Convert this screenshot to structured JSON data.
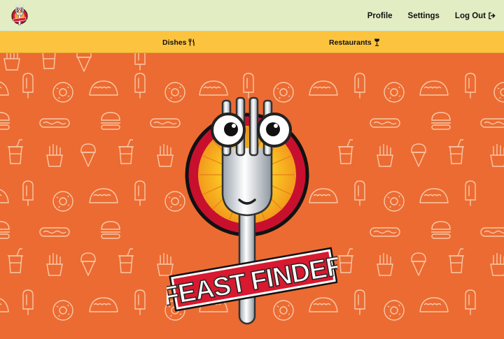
{
  "header": {
    "logo_icon": "fork-mascot-icon",
    "nav": {
      "profile": "Profile",
      "settings": "Settings",
      "logout": "Log Out",
      "logout_icon": "sign-out-icon"
    }
  },
  "subnav": {
    "dishes": "Dishes",
    "dishes_icon": "utensils-icon",
    "restaurants": "Restaurants",
    "restaurants_icon": "wine-glass-icon"
  },
  "hero": {
    "brand": "FEAST FINDER",
    "brand_word_1": "FEAST",
    "brand_word_2": "FINDER",
    "pattern_icons": [
      "ice-pop-icon",
      "donut-icon",
      "taco-icon",
      "hot-dog-icon",
      "burger-icon",
      "soda-cup-icon",
      "fries-icon",
      "ice-cream-cone-icon"
    ]
  },
  "colors": {
    "header_bg": "#e3edc4",
    "subnav_bg": "#fcc43e",
    "hero_bg": "#ec6b32",
    "brand_red": "#d8192f"
  }
}
